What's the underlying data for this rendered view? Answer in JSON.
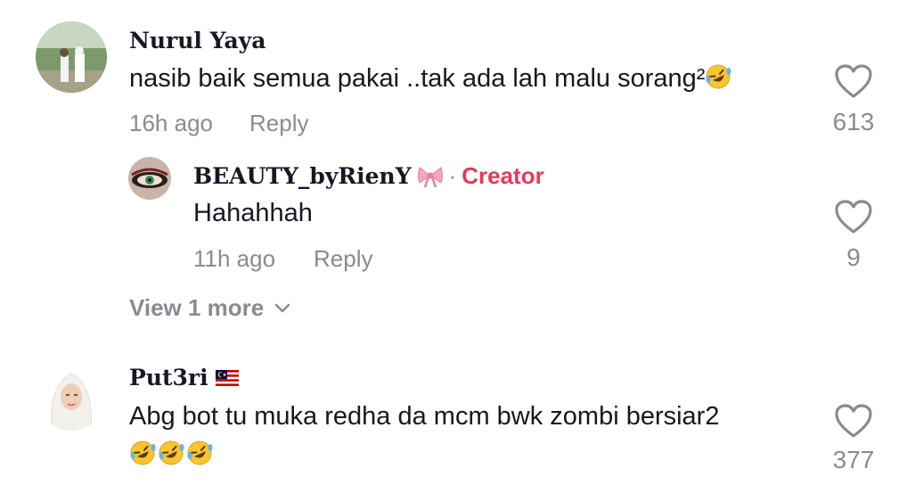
{
  "comments": [
    {
      "username": "Nurul Yaya",
      "text": "nasib baik semua pakai ..tak ada lah malu sorang²",
      "emoji": "rolling-laughing-emoji",
      "time": "16h ago",
      "reply_label": "Reply",
      "likes": "613",
      "avatar": "couple-photo-avatar"
    },
    {
      "username": "Put3ri",
      "flag": "malaysia-flag-icon",
      "text": "Abg bot tu muka redha da mcm bwk zombi bersiar2",
      "emoji_line": "3 rolling-laughing-emoji",
      "likes": "377",
      "avatar": "hijab-woman-avatar"
    }
  ],
  "reply": {
    "username": "BEAUTY_byRienY",
    "username_icon": "pink-bow-icon",
    "separator": "·",
    "badge": "Creator",
    "text": "Hahahhah",
    "time": "11h ago",
    "reply_label": "Reply",
    "likes": "9",
    "avatar": "eye-makeup-avatar"
  },
  "view_more": {
    "label": "View 1 more",
    "icon": "chevron-down-icon"
  },
  "colors": {
    "creator": "#e63a59",
    "secondary": "#8a8b91",
    "primary": "#161823"
  }
}
